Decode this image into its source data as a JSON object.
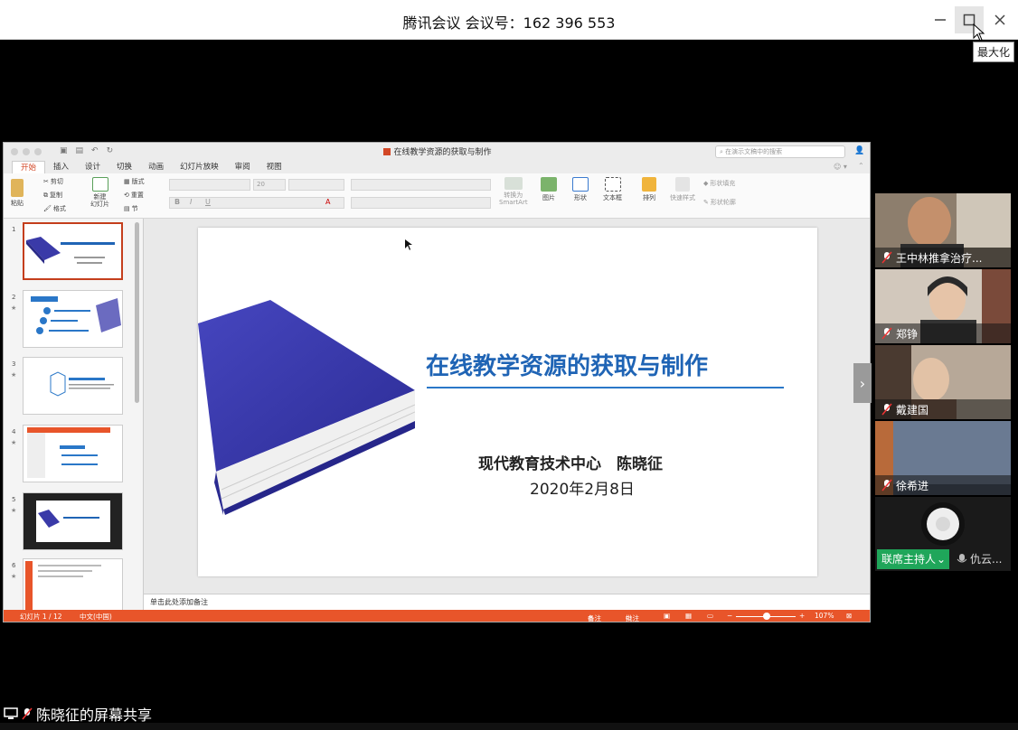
{
  "window": {
    "title": "腾讯会议 会议号：162 396 553",
    "tooltip": "最大化"
  },
  "ppt": {
    "doc_title": "在线教学资源的获取与制作",
    "search_placeholder": "在演示文稿中的搜索",
    "tabs": [
      "开始",
      "插入",
      "设计",
      "切换",
      "动画",
      "幻灯片放映",
      "审阅",
      "视图"
    ],
    "ribbon": {
      "paste": "粘贴",
      "cut": "剪切",
      "copy": "复制",
      "format": "格式",
      "new_slide": "新建\n幻灯片",
      "layout": "版式",
      "reset": "重置",
      "section": "节",
      "font_size": "20",
      "smartart": "转换为\nSmartArt",
      "picture": "图片",
      "shape": "形状",
      "textbox": "文本框",
      "arrange": "排列",
      "quick_styles": "快速样式",
      "shape_fill": "形状填充",
      "shape_outline": "形状轮廓"
    },
    "thumbnails": [
      {
        "num": "1"
      },
      {
        "num": "2"
      },
      {
        "num": "3"
      },
      {
        "num": "4"
      },
      {
        "num": "5"
      },
      {
        "num": "6"
      }
    ],
    "slide": {
      "title": "在线教学资源的获取与制作",
      "author": "现代教育技术中心　陈晓征",
      "date": "2020年2月8日",
      "accent": "#1f64b5",
      "book_color": "#3a3aa8"
    },
    "notes_placeholder": "单击此处添加备注",
    "status": {
      "slide_index": "幻灯片 1 / 12",
      "language": "中文(中国)",
      "notes_btn": "备注",
      "comments_btn": "批注",
      "zoom": "107%"
    }
  },
  "participants": [
    {
      "name": "王中林推拿治疗..."
    },
    {
      "name": "郑铮"
    },
    {
      "name": "戴建国"
    },
    {
      "name": "徐希进"
    },
    {
      "name_host": "联席主持人",
      "name_other": "仇云..."
    }
  ],
  "share_label": "陈晓征的屏幕共享"
}
